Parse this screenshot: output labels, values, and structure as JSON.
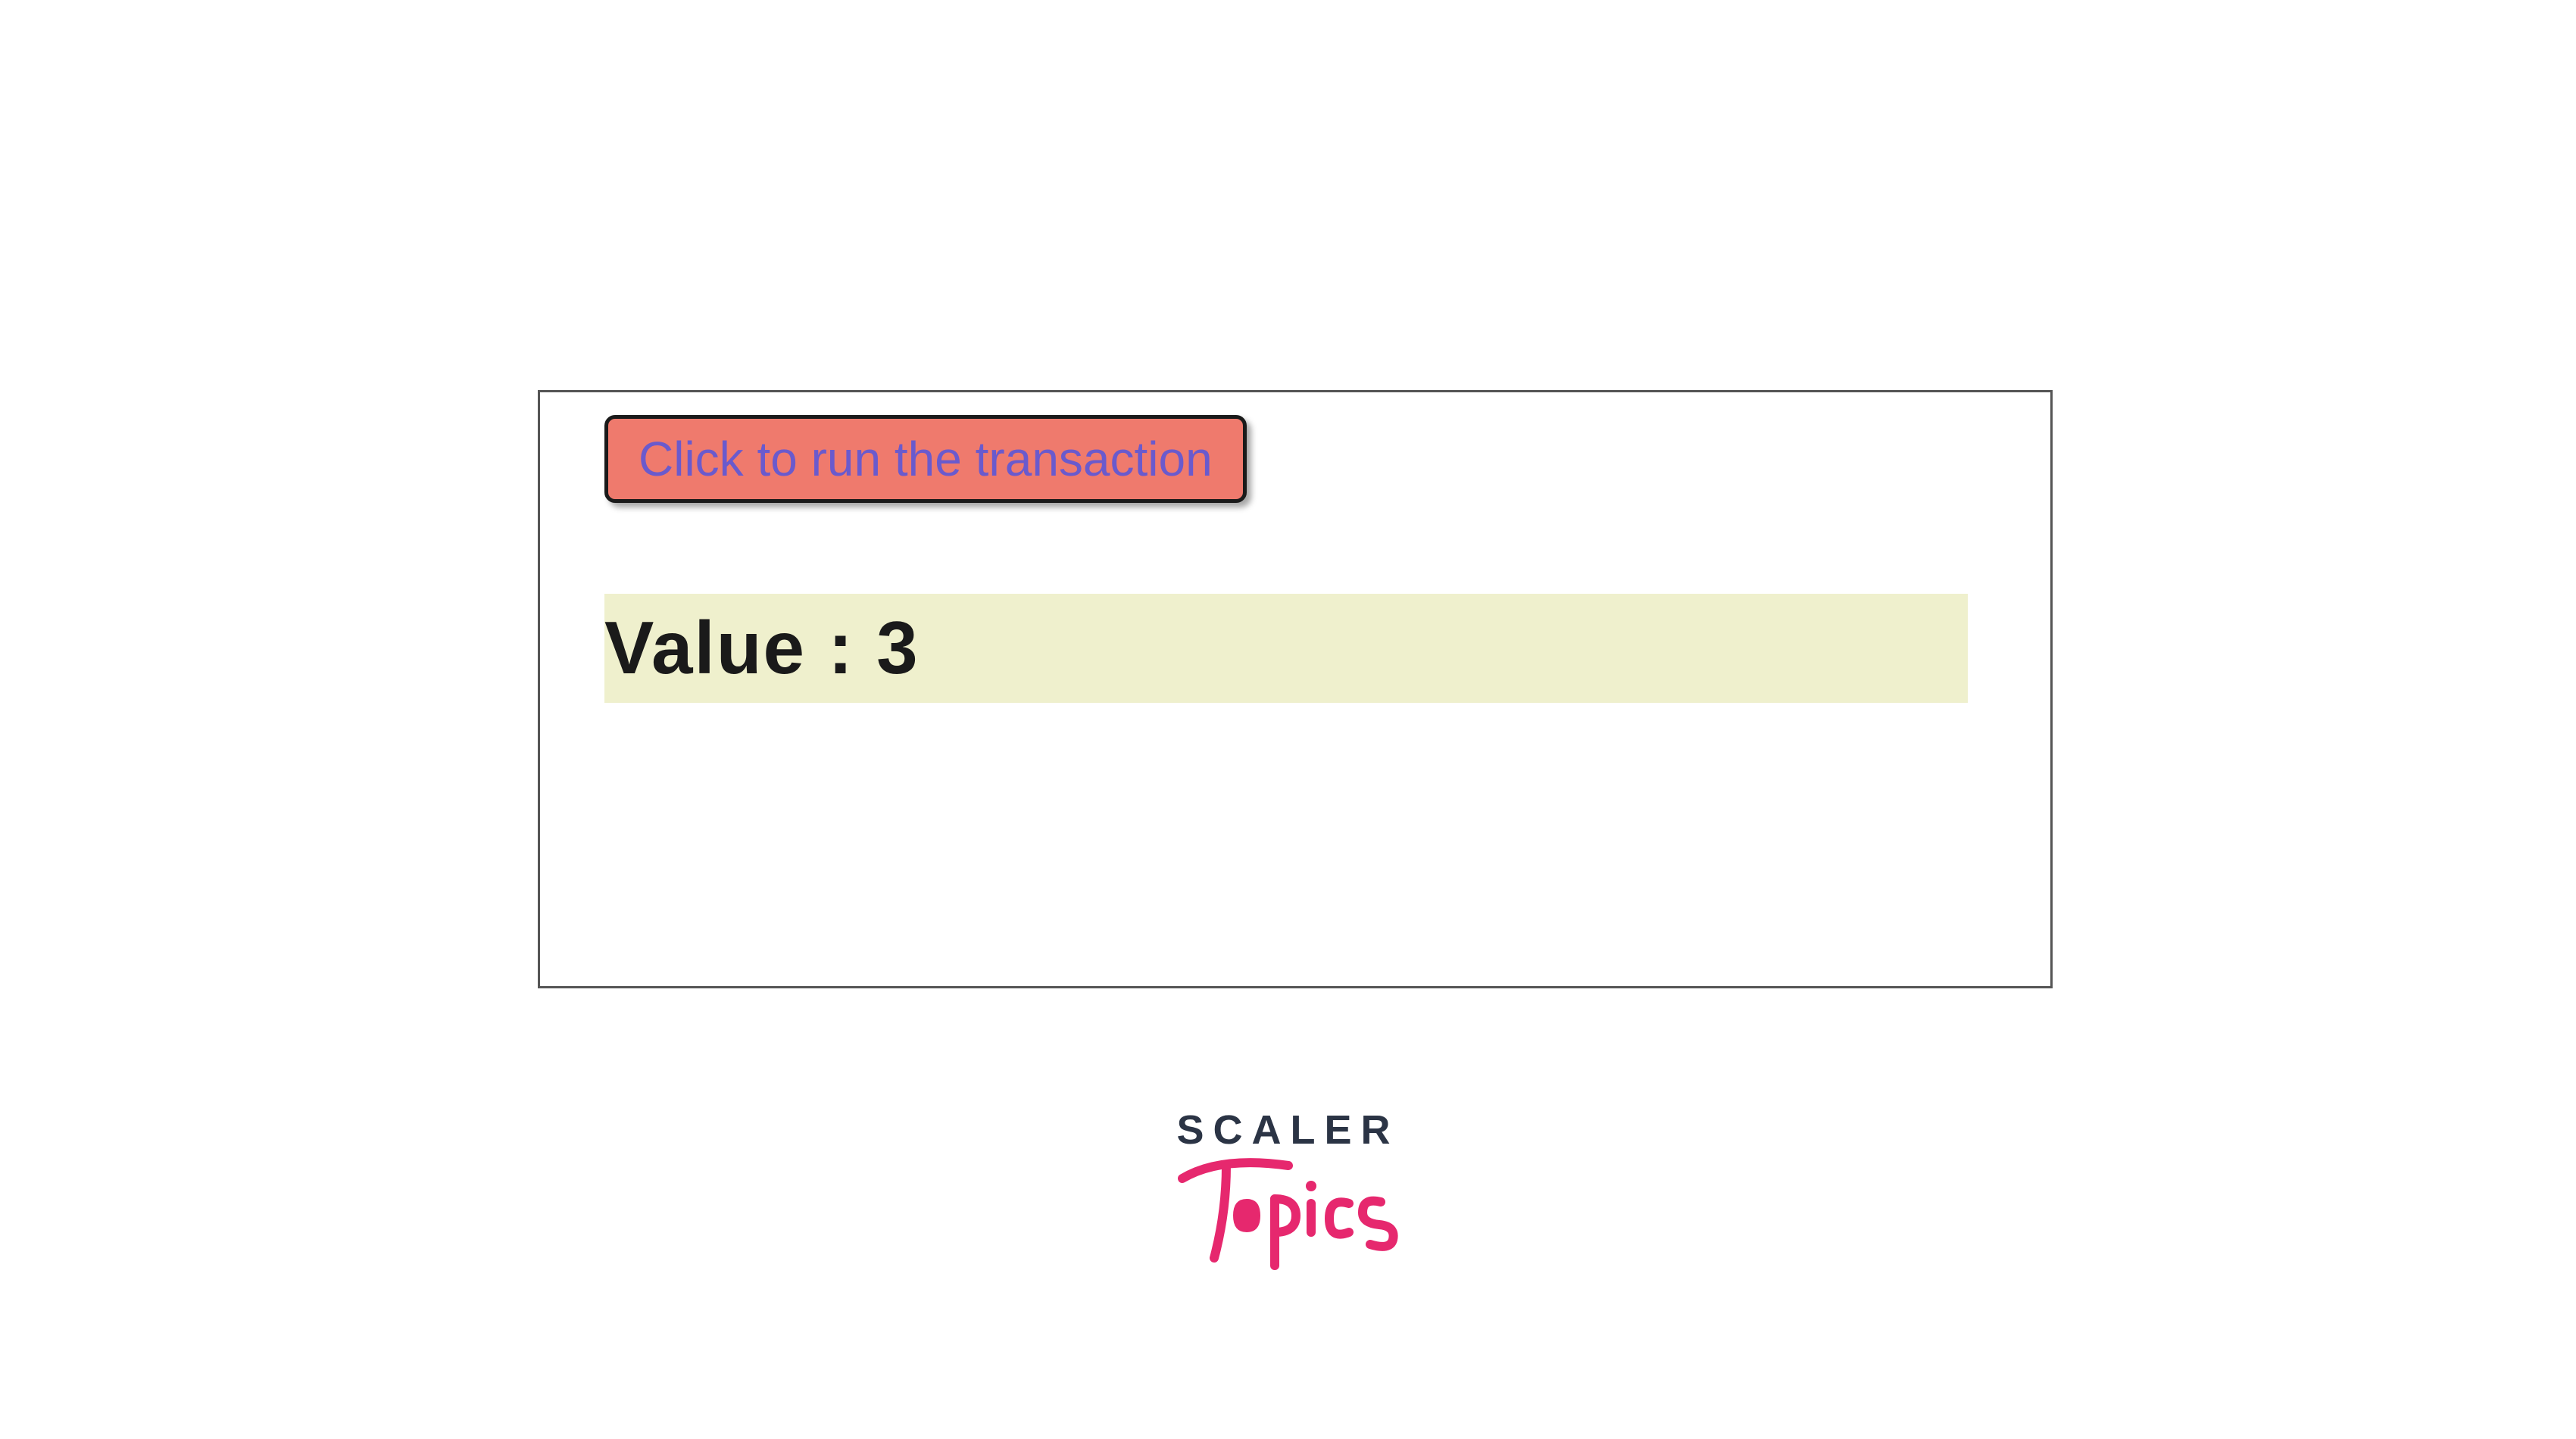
{
  "panel": {
    "button_label": "Click to run the transaction",
    "value_label": "Value : 3"
  },
  "logo": {
    "top": "SCALER",
    "bottom": "Topics"
  },
  "colors": {
    "button_bg": "#ef7a6d",
    "button_text": "#6a5acd",
    "value_bg": "#eff0cd",
    "logo_dark": "#2b3445",
    "logo_pink": "#e6286e"
  }
}
